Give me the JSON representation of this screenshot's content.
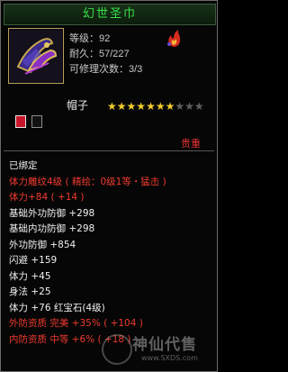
{
  "item": {
    "name": "幻世圣巾",
    "level_line": "等级：92",
    "durability_line": "耐久：57/227",
    "repairs_line": "可修理次数：3/3",
    "type": "帽子",
    "stars_total": 10,
    "stars_filled": 7,
    "rarity": "贵重",
    "slots": [
      "red",
      "empty"
    ]
  },
  "colors": {
    "title": "#37e24a",
    "red": "#f03a2f",
    "gold_star": "#f4ce2c",
    "white": "#f0f0f0"
  },
  "lines": [
    {
      "text": "已绑定",
      "color": "w"
    },
    {
      "text": "体力雕纹4级 ( 精绘：0级1等・猛击 )",
      "color": "r"
    },
    {
      "text": "体力+84 ( +14 )",
      "color": "r"
    },
    {
      "text": "基础外功防御 +298",
      "color": "w"
    },
    {
      "text": "基础内功防御 +298",
      "color": "w"
    },
    {
      "text": "外功防御 +854",
      "color": "w"
    },
    {
      "text": "闪避 +159",
      "color": "w"
    },
    {
      "text": "体力 +45",
      "color": "w"
    },
    {
      "text": "身法 +25",
      "color": "w"
    },
    {
      "text": "体力 +76 红宝石(4级)",
      "color": "w"
    },
    {
      "text": "外防资质 完美 +35% ( +104 )",
      "color": "r"
    },
    {
      "text": "内防资质 中等 +6% ( +18 )",
      "color": "r"
    }
  ],
  "watermark": {
    "brand": "神仙代售",
    "url": "www.SXDS.com"
  }
}
